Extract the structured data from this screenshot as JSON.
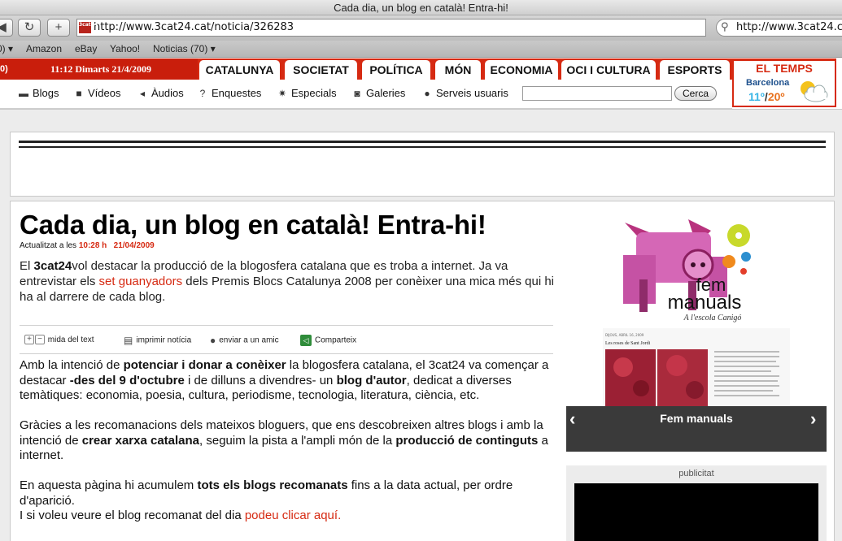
{
  "browser": {
    "window_title": "Cada dia, un blog en català! Entra-hi!",
    "back_label": "◀",
    "reload_label": "↻",
    "newtab_label": "+",
    "url": "http://www.3cat24.cat/noticia/326283",
    "favicon_text": "3cat24",
    "search_value": "http://www.3cat24.cat",
    "bookmarks": [
      {
        "label": "0) ▾"
      },
      {
        "label": "Amazon"
      },
      {
        "label": "eBay"
      },
      {
        "label": "Yahoo!"
      },
      {
        "label": "Noticias (70) ▾"
      }
    ]
  },
  "site": {
    "datetime": "11:12 Dimarts 21/4/2009",
    "date_left": "0)",
    "nav_tabs": [
      {
        "label": "CATALUNYA"
      },
      {
        "label": "SOCIETAT"
      },
      {
        "label": "POLÍTICA"
      },
      {
        "label": "MÓN"
      },
      {
        "label": "ECONOMIA"
      },
      {
        "label": "OCI I CULTURA"
      },
      {
        "label": "ESPORTS"
      }
    ],
    "subnav": [
      {
        "label": "Blogs",
        "icon": "speech-bubble-icon"
      },
      {
        "label": "Vídeos",
        "icon": "video-camera-icon"
      },
      {
        "label": "Àudios",
        "icon": "speaker-icon"
      },
      {
        "label": "Enquestes",
        "icon": "question-icon"
      },
      {
        "label": "Especials",
        "icon": "star-burst-icon"
      },
      {
        "label": "Galeries",
        "icon": "camera-icon"
      },
      {
        "label": "Serveis usuaris",
        "icon": "users-icon"
      }
    ],
    "search_button": "Cerca",
    "weather": {
      "title": "EL TEMPS",
      "city": "Barcelona",
      "tmin": "11º",
      "sep": "/",
      "tmax": "20º"
    }
  },
  "article": {
    "title": "Cada dia, un blog en català! Entra-hi!",
    "updated_prefix": "Actualitzat a les",
    "updated_time": "10:28 h",
    "updated_date": "21/04/2009",
    "lead": {
      "p1": "El ",
      "brand": "3cat24",
      "p2": "vol destacar la producció de la blogosfera catalana que es troba a internet. Ja va entrevistar els ",
      "link": "set guanyadors",
      "p3": " dels Premis Blocs Catalunya 2008 per conèixer una mica més qui hi ha al darrere de cada blog."
    },
    "tools": {
      "font_size": "mida del text",
      "print": "imprimir notícia",
      "send": "enviar a un amic",
      "share": "Comparteix"
    },
    "para1": {
      "a": "Amb la intenció de ",
      "b": "potenciar i donar a conèixer",
      "c": " la blogosfera catalana, el 3cat24 va començar a destacar ",
      "d": "-des del 9 d'octubre",
      "e": " i de dilluns a divendres- un ",
      "f": "blog d'autor",
      "g": ", dedicat a diverses temàtiques: economia, poesia, cultura, periodisme, tecnologia, literatura, ciència, etc."
    },
    "para2": {
      "a": "Gràcies a les recomanacions dels mateixos bloguers, que ens descobreixen altres blogs i amb la intenció de ",
      "b": "crear xarxa catalana",
      "c": ", seguim la pista a l'ampli món de la ",
      "d": "producció de continguts",
      "e": " a internet."
    },
    "para3": {
      "a": "En aquesta pàgina hi acumulem ",
      "b": "tots els blogs recomanats",
      "c": " fins a la data actual, per ordre d'aparició.",
      "d": "I si voleu veure el blog recomanat del dia ",
      "link": "podeu clicar aquí."
    }
  },
  "sidebar": {
    "promo_title_1": "fem",
    "promo_title_2": "manuals",
    "promo_subtitle": "A l'escola Canigó",
    "mini_post_title": "Les roses de Sant Jordi",
    "mini_post_date": "DIJOUS, ABRIL 16, 2009",
    "caption": "Fem manuals",
    "prev": "‹",
    "next": "›",
    "ad_label": "publicitat"
  },
  "colors": {
    "brand_red": "#d62a12",
    "dark_caption": "#3a3a3a"
  }
}
